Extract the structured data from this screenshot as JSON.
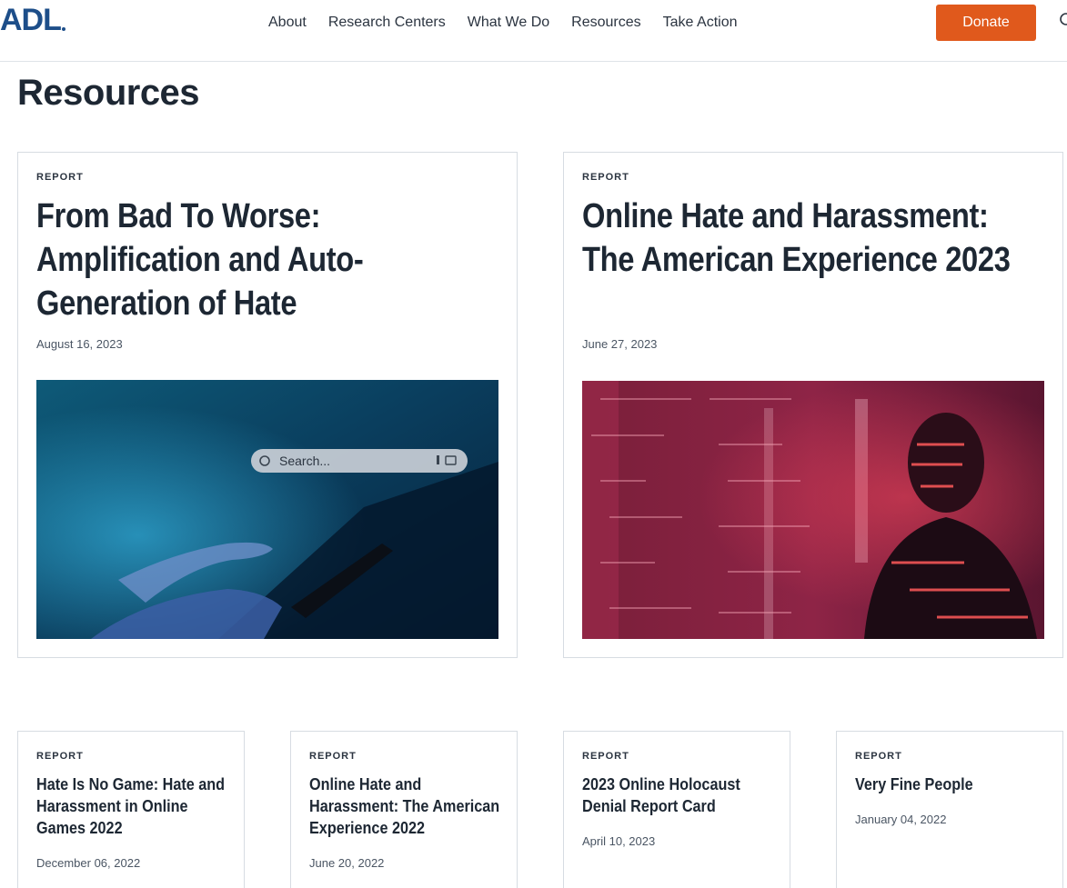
{
  "header": {
    "logo_text": "ADL",
    "nav": [
      "About",
      "Research Centers",
      "What We Do",
      "Resources",
      "Take Action"
    ],
    "donate_label": "Donate"
  },
  "page": {
    "title": "Resources"
  },
  "featured": [
    {
      "kicker": "REPORT",
      "title": "From Bad To Worse: Amplification and Auto-Generation of Hate",
      "date": "August 16, 2023",
      "image": {
        "search_placeholder": "Search..."
      }
    },
    {
      "kicker": "REPORT",
      "title": "Online Hate and Harassment: The American Experience 2023",
      "date": "June 27, 2023"
    }
  ],
  "cards": [
    {
      "kicker": "REPORT",
      "title": "Hate Is No Game: Hate and Harassment in Online Games 2022",
      "date": "December 06, 2022"
    },
    {
      "kicker": "REPORT",
      "title": "Online Hate and Harassment: The American Experience 2022",
      "date": "June 20, 2022"
    },
    {
      "kicker": "REPORT",
      "title": "2023 Online Holocaust Denial Report Card",
      "date": "April 10, 2023"
    },
    {
      "kicker": "REPORT",
      "title": "Very Fine People",
      "date": "January 04, 2022"
    }
  ],
  "colors": {
    "brand": "#1d4e89",
    "donate": "#e0591c",
    "text": "#1d2733",
    "border": "#d7dce2"
  }
}
